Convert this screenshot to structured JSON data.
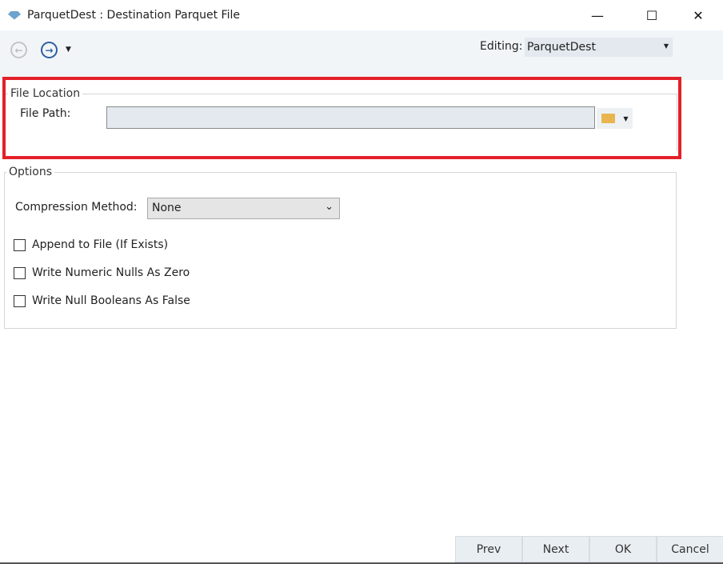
{
  "window": {
    "title": "ParquetDest : Destination Parquet File",
    "minimize": "—",
    "maximize": "☐",
    "close": "✕"
  },
  "toolbar": {
    "back_icon": "arrow-left-circle",
    "forward_icon": "arrow-right-circle",
    "editing_label": "Editing:",
    "editing_value": "ParquetDest"
  },
  "file_location": {
    "legend": "File Location",
    "file_path_label": "File Path:",
    "file_path_value": ""
  },
  "options": {
    "legend": "Options",
    "compression_label": "Compression Method:",
    "compression_value": "None",
    "checkboxes": [
      {
        "label": "Append to File (If Exists)",
        "checked": false
      },
      {
        "label": "Write Numeric Nulls As Zero",
        "checked": false
      },
      {
        "label": "Write Null Booleans As False",
        "checked": false
      }
    ]
  },
  "buttons": {
    "prev": "Prev",
    "next": "Next",
    "ok": "OK",
    "cancel": "Cancel"
  },
  "colors": {
    "highlight": "#e3202a",
    "accent": "#2e5fa3"
  }
}
